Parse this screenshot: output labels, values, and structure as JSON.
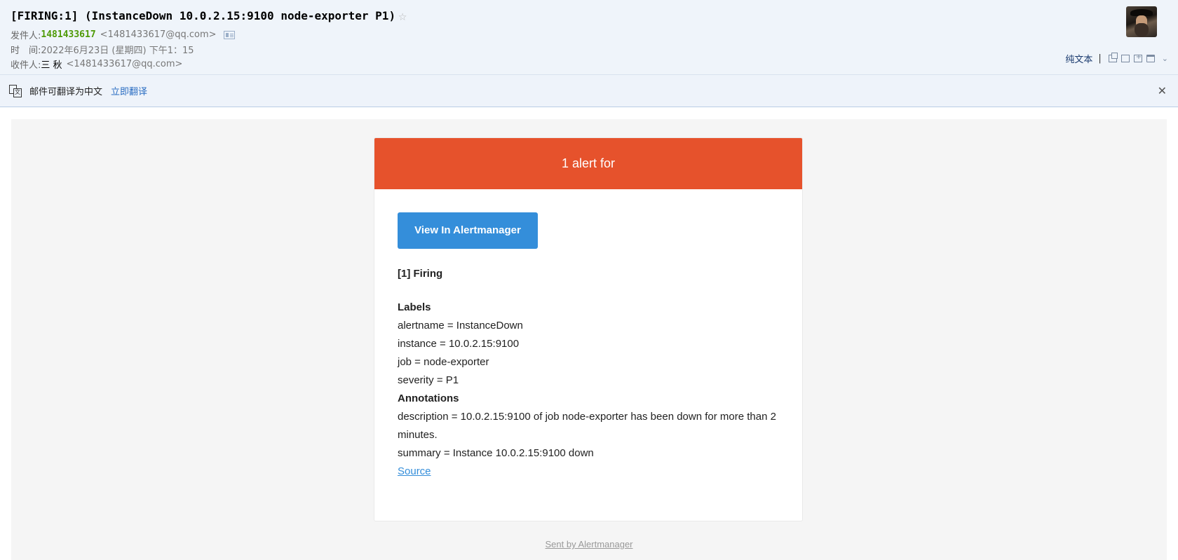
{
  "header": {
    "subject": "[FIRING:1] (InstanceDown 10.0.2.15:9100 node-exporter P1)",
    "star_icon": "☆",
    "from_label": "发件人:",
    "from_name": "1481433617",
    "from_address": "<1481433617@qq.com>",
    "time_label": "时　间:",
    "time_value": "2022年6月23日 (星期四) 下午1：15",
    "to_label": "收件人:",
    "to_name": "三 秋",
    "to_address": "<1481433617@qq.com>"
  },
  "toolbar": {
    "plain_text": "纯文本",
    "separator": "|",
    "chevron": "⌄"
  },
  "translate_bar": {
    "icon_glyph": "文",
    "text": "邮件可翻译为中文",
    "link": "立即翻译",
    "close": "✕"
  },
  "alert": {
    "banner": "1 alert for",
    "button": "View In Alertmanager",
    "firing": "[1] Firing",
    "labels_heading": "Labels",
    "labels": [
      "alertname = InstanceDown",
      "instance = 10.0.2.15:9100",
      "job = node-exporter",
      "severity = P1"
    ],
    "annotations_heading": "Annotations",
    "annotations": [
      "description = 10.0.2.15:9100 of job node-exporter has been down for more than 2 minutes.",
      "summary = Instance 10.0.2.15:9100 down"
    ],
    "source_link": "Source",
    "footer": "Sent by Alertmanager"
  },
  "colors": {
    "banner": "#e6522c",
    "button": "#348eda",
    "sender": "#4e9a06"
  }
}
